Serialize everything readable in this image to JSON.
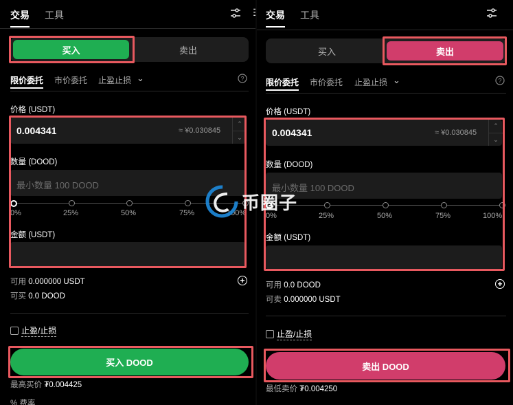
{
  "colors": {
    "buy": "#1fae52",
    "sell": "#d13d6b",
    "highlight": "#e8595f",
    "watermark_blue": "#1e88d8"
  },
  "watermark": {
    "text": "币圈子"
  },
  "panels": [
    {
      "side": "buy",
      "tabs": [
        "交易",
        "工具"
      ],
      "settings_icon": "sliders-icon",
      "segment": {
        "buy_label": "买入",
        "sell_label": "卖出",
        "active": "buy"
      },
      "order_types": [
        "限价委托",
        "市价委托",
        "止盈止损"
      ],
      "order_type_active": "限价委托",
      "help_icon": "question-circle-icon",
      "price": {
        "label": "价格 (USDT)",
        "value": "0.004341",
        "converted": "≈ ¥0.030845"
      },
      "quantity": {
        "label": "数量 (DOOD)",
        "placeholder": "最小数量 100 DOOD"
      },
      "slider": {
        "ticks": [
          "0%",
          "25%",
          "50%",
          "75%",
          "100%"
        ],
        "value_percent": 0
      },
      "amount": {
        "label": "金额 (USDT)"
      },
      "available": {
        "label": "可用",
        "value": "0.000000 USDT"
      },
      "can_trade": {
        "label": "可买",
        "value": "0.0 DOOD"
      },
      "tpsl_label": "止盈/止损",
      "action_button": "买入 DOOD",
      "footer": {
        "label": "最高买价",
        "value": "₮0.004425"
      },
      "fee": "% 费率"
    },
    {
      "side": "sell",
      "tabs": [
        "交易",
        "工具"
      ],
      "settings_icon": "sliders-icon",
      "segment": {
        "buy_label": "买入",
        "sell_label": "卖出",
        "active": "sell"
      },
      "order_types": [
        "限价委托",
        "市价委托",
        "止盈止损"
      ],
      "order_type_active": "限价委托",
      "help_icon": "question-circle-icon",
      "price": {
        "label": "价格 (USDT)",
        "value": "0.004341",
        "converted": "≈ ¥0.030845"
      },
      "quantity": {
        "label": "数量 (DOOD)",
        "placeholder": "最小数量 100 DOOD"
      },
      "slider": {
        "ticks": [
          "0%",
          "25%",
          "50%",
          "75%",
          "100%"
        ],
        "value_percent": 0
      },
      "amount": {
        "label": "金额 (USDT)"
      },
      "available": {
        "label": "可用",
        "value": "0.0 DOOD"
      },
      "can_trade": {
        "label": "可卖",
        "value": "0.000000 USDT"
      },
      "tpsl_label": "止盈/止损",
      "action_button": "卖出 DOOD",
      "footer": {
        "label": "最低卖价",
        "value": "₮0.004250"
      }
    }
  ]
}
